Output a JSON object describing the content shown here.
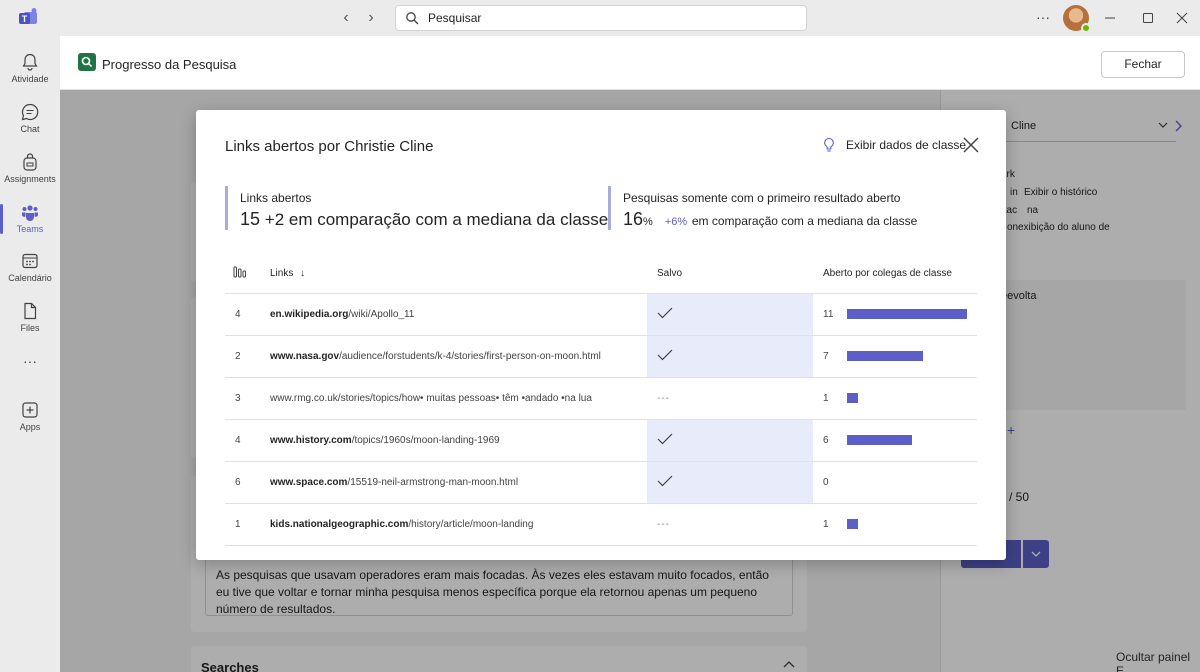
{
  "titlebar": {
    "search_placeholder": "Pesquisar",
    "more_label": "···"
  },
  "rail": [
    {
      "label": "Atividade",
      "icon": "bell-icon"
    },
    {
      "label": "Chat",
      "icon": "chat-icon"
    },
    {
      "label": "Assignments",
      "icon": "backpack-icon"
    },
    {
      "label": "Teams",
      "icon": "teams-icon",
      "active": true
    },
    {
      "label": "Calendário",
      "icon": "calendar-icon"
    },
    {
      "label": "Files",
      "icon": "file-icon"
    },
    {
      "label": "···",
      "icon": "more-icon"
    },
    {
      "label": "Apps",
      "icon": "add-apps-icon"
    }
  ],
  "app": {
    "title": "Progresso da Pesquisa",
    "close_label": "Fechar"
  },
  "side_panel": {
    "student": "Cline",
    "work_label": "ork",
    "in_label": "in",
    "history_label": "Exibir o histórico",
    "na_label": "na",
    "attac_label": "ttac",
    "view_label": "exibição do aluno de",
    "on_label": "on",
    "returned_label": "eevolta",
    "score_label": "/ 50",
    "hide_panel_label": "Ocultar painel E"
  },
  "background": {
    "reflection_text": "As pesquisas que usavam operadores eram mais focadas. Às vezes eles estavam muito focados, então eu tive que voltar e tornar minha pesquisa menos específica porque ela retornou apenas um pequeno número de resultados.",
    "searches_header": "Searches"
  },
  "dialog": {
    "title": "Links abertos por Christie Cline",
    "show_class_data": "Exibir dados de classe",
    "stats": {
      "links_opened": {
        "label": "Links abertos",
        "value": "15",
        "comparison": "+2 em comparação com a mediana da classe"
      },
      "first_result": {
        "label": "Pesquisas somente com o primeiro resultado aberto",
        "value": "16",
        "unit": "%",
        "delta": "+6%",
        "comparison": "em comparação com a mediana da classe"
      }
    },
    "table": {
      "headers": {
        "links": "Links",
        "saved": "Salvo",
        "peers": "Aberto por colegas de classe"
      },
      "max_peers": 11,
      "rows": [
        {
          "count": "4",
          "domain": "en.wikipedia.org",
          "path": "/wiki/Apollo_11",
          "bold": true,
          "saved": true,
          "peers": 11
        },
        {
          "count": "2",
          "domain": "www.nasa.gov",
          "path": "/audience/forstudents/k-4/stories/first-person-on-moon.html",
          "bold": true,
          "saved": true,
          "peers": 7
        },
        {
          "count": "3",
          "domain": "",
          "path": "www.rmg.co.uk/stories/topics/how• muitas pessoas• têm •andado •na lua",
          "bold": false,
          "saved": false,
          "peers": 1
        },
        {
          "count": "4",
          "domain": "www.history.com",
          "path": "/topics/1960s/moon-landing-1969",
          "bold": true,
          "saved": true,
          "peers": 6
        },
        {
          "count": "6",
          "domain": "www.space.com",
          "path": "/15519-neil-armstrong-man-moon.html",
          "bold": true,
          "saved": true,
          "peers": 0
        },
        {
          "count": "1",
          "domain": "kids.nationalgeographic.com",
          "path": "/history/article/moon-landing",
          "bold": true,
          "saved": false,
          "peers": 1
        }
      ],
      "unsaved_marker": "---"
    }
  },
  "colors": {
    "accent": "#5b5fc7",
    "saved_bg": "#e8ebfa",
    "stat_border": "#a9abdf"
  }
}
